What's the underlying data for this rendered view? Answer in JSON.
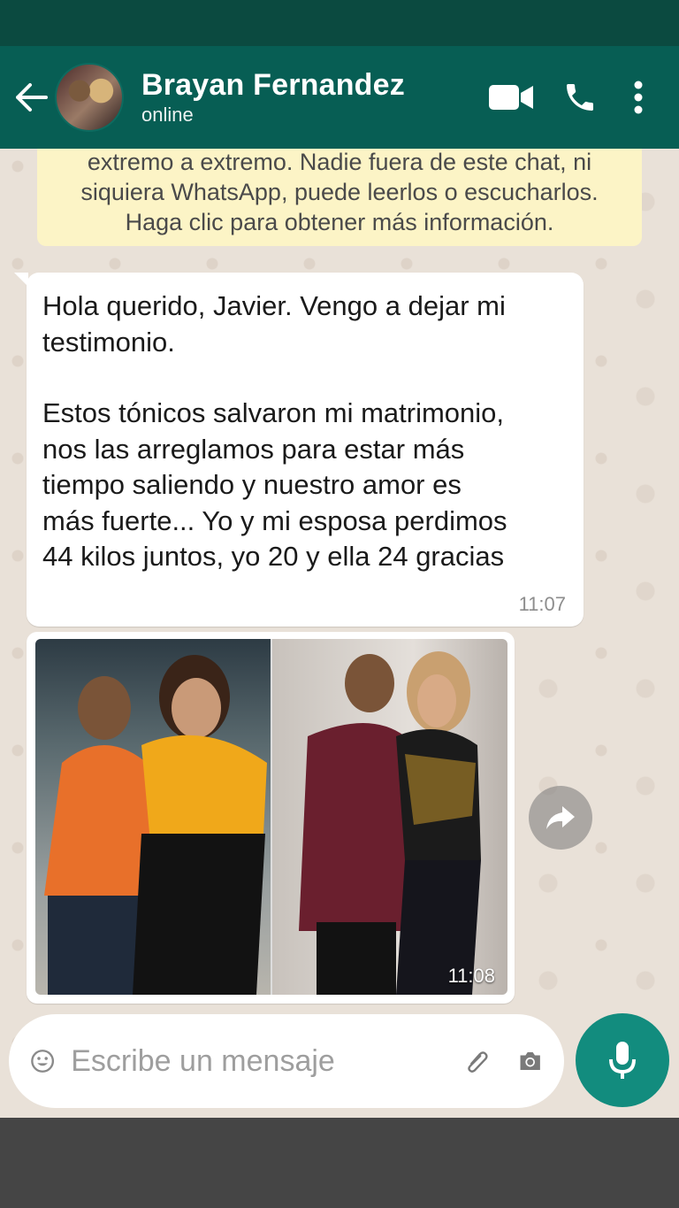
{
  "header": {
    "contact_name": "Brayan Fernandez",
    "status": "online"
  },
  "encryption_banner": {
    "lines": [
      "extremo a extremo. Nadie fuera de este chat, ni",
      "siquiera WhatsApp, puede leerlos o escucharlos.",
      "Haga clic para obtener más información."
    ]
  },
  "messages": [
    {
      "type": "text",
      "lines": [
        "Hola querido, Javier. Vengo a dejar mi",
        "testimonio.",
        "",
        "Estos tónicos salvaron mi matrimonio,",
        "nos las arreglamos para estar más",
        "tiempo saliendo y nuestro amor es",
        "más fuerte... Yo y mi esposa perdimos",
        "44 kilos juntos, yo 20 y ella 24 gracias"
      ],
      "time": "11:07"
    },
    {
      "type": "image",
      "time": "11:08"
    }
  ],
  "input": {
    "placeholder": "Escribe un mensaje"
  },
  "icons": {
    "back": "arrow-back-icon",
    "video": "video-call-icon",
    "call": "phone-icon",
    "menu": "more-vert-icon",
    "forward": "forward-icon",
    "emoji": "emoji-icon",
    "attach": "paperclip-icon",
    "camera": "camera-icon",
    "mic": "microphone-icon"
  },
  "colors": {
    "header": "#075e54",
    "status_bar": "#0b4a40",
    "accent": "#128c7e",
    "chat_background": "#e9e1d8",
    "banner": "#fcf4c6"
  }
}
